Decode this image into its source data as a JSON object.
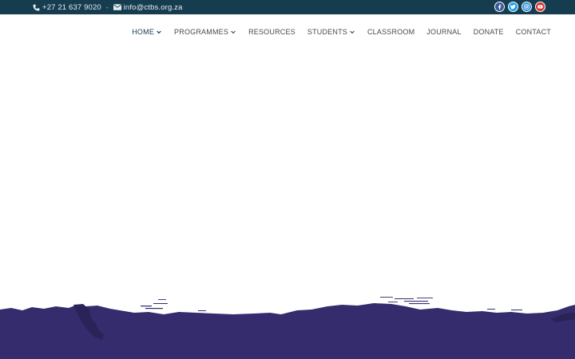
{
  "topbar": {
    "phone": "+27 21 637 9020",
    "separator": "-",
    "email": "info@ctbs.org.za",
    "social": [
      {
        "name": "facebook",
        "color": "#3b5998",
        "glyph": "f"
      },
      {
        "name": "twitter",
        "color": "#1da1f2",
        "glyph": "t"
      },
      {
        "name": "instagram",
        "color": "#2e8fd8",
        "glyph": "o"
      },
      {
        "name": "youtube",
        "color": "#d8332f",
        "glyph": "▶"
      }
    ]
  },
  "nav": {
    "items": [
      {
        "label": "HOME",
        "dropdown": true,
        "active": true
      },
      {
        "label": "PROGRAMMES",
        "dropdown": true
      },
      {
        "label": "RESOURCES",
        "dropdown": false
      },
      {
        "label": "STUDENTS",
        "dropdown": true
      },
      {
        "label": "CLASSROOM",
        "dropdown": false
      },
      {
        "label": "JOURNAL",
        "dropdown": false
      },
      {
        "label": "DONATE",
        "dropdown": false
      },
      {
        "label": "CONTACT",
        "dropdown": false
      }
    ]
  },
  "colors": {
    "topbar": "#163c50",
    "accent": "#163c50",
    "wave": "#342c6d",
    "nav_text": "#4a4a4a"
  }
}
